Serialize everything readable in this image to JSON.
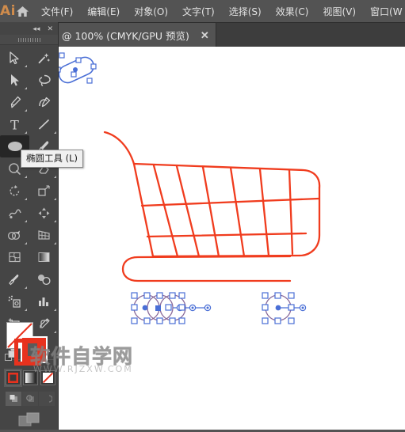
{
  "app": {
    "logo_text": "Ai",
    "home_icon": "home-icon"
  },
  "menubar": {
    "items": [
      {
        "label": "文件(F)",
        "name": "menu-file"
      },
      {
        "label": "编辑(E)",
        "name": "menu-edit"
      },
      {
        "label": "对象(O)",
        "name": "menu-object"
      },
      {
        "label": "文字(T)",
        "name": "menu-type"
      },
      {
        "label": "选择(S)",
        "name": "menu-select"
      },
      {
        "label": "效果(C)",
        "name": "menu-effect"
      },
      {
        "label": "视图(V)",
        "name": "menu-view"
      },
      {
        "label": "窗口(W",
        "name": "menu-window"
      }
    ]
  },
  "tabbar": {
    "tab_title": "@ 100% (CMYK/GPU 预览)",
    "close_label": "✕"
  },
  "toolpanel": {
    "collapse_label": "◂◂",
    "close_label": "✕",
    "tools": [
      {
        "name": "selection-tool",
        "icon": "arrow-outline-icon",
        "has_corner": true
      },
      {
        "name": "magic-wand-tool",
        "icon": "magic-wand-icon",
        "has_corner": false
      },
      {
        "name": "direct-selection-tool",
        "icon": "arrow-filled-icon",
        "has_corner": true
      },
      {
        "name": "lasso-tool",
        "icon": "lasso-icon",
        "has_corner": false
      },
      {
        "name": "pen-tool",
        "icon": "pen-icon",
        "has_corner": true
      },
      {
        "name": "curvature-tool",
        "icon": "curvature-icon",
        "has_corner": false
      },
      {
        "name": "type-tool",
        "icon": "type-t-icon",
        "has_corner": true
      },
      {
        "name": "line-segment-tool",
        "icon": "line-diagonal-icon",
        "has_corner": true
      },
      {
        "name": "ellipse-tool",
        "icon": "ellipse-icon",
        "has_corner": true
      },
      {
        "name": "paintbrush-tool",
        "icon": "paintbrush-icon",
        "has_corner": true
      },
      {
        "name": "shaper-tool",
        "icon": "shaper-icon",
        "has_corner": true
      },
      {
        "name": "eraser-tool",
        "icon": "eraser-icon",
        "has_corner": true
      },
      {
        "name": "rotate-tool",
        "icon": "rotate-icon",
        "has_corner": true
      },
      {
        "name": "scale-tool",
        "icon": "scale-icon",
        "has_corner": true
      },
      {
        "name": "width-tool",
        "icon": "width-warp-icon",
        "has_corner": true
      },
      {
        "name": "free-transform-tool",
        "icon": "free-transform-icon",
        "has_corner": true
      },
      {
        "name": "shape-builder-tool",
        "icon": "shape-builder-icon",
        "has_corner": true
      },
      {
        "name": "perspective-grid-tool",
        "icon": "perspective-grid-icon",
        "has_corner": true
      },
      {
        "name": "mesh-tool",
        "icon": "mesh-icon",
        "has_corner": false
      },
      {
        "name": "gradient-tool",
        "icon": "gradient-icon",
        "has_corner": false
      },
      {
        "name": "eyedropper-tool",
        "icon": "eyedropper-icon",
        "has_corner": true
      },
      {
        "name": "blend-tool",
        "icon": "blend-icon",
        "has_corner": false
      },
      {
        "name": "symbol-sprayer-tool",
        "icon": "symbol-sprayer-icon",
        "has_corner": true
      },
      {
        "name": "column-graph-tool",
        "icon": "bar-chart-icon",
        "has_corner": true
      },
      {
        "name": "artboard-tool",
        "icon": "artboard-icon",
        "has_corner": false
      },
      {
        "name": "slice-tool",
        "icon": "knife-icon",
        "has_corner": true
      },
      {
        "name": "hand-tool",
        "icon": "hand-icon",
        "has_corner": true
      },
      {
        "name": "zoom-tool",
        "icon": "magnifier-icon",
        "has_corner": false
      }
    ],
    "active_tool_index": 8
  },
  "tooltip": {
    "text": "椭圆工具 (L)"
  },
  "colors": {
    "fill": "#ffffff",
    "fill_is_none": true,
    "stroke": "#e8321e",
    "none_slash": "#e8321e",
    "artwork_stroke": "#f03c1e",
    "selection_blue": "#4a6fd6",
    "accent_orange": "#d08c4c",
    "panel_bg": "#454545",
    "chrome_bg": "#535353",
    "tabbar_bg": "#3d3d3d",
    "canvas_bg": "#ffffff"
  },
  "color_controls": {
    "fill_name": "fill-swatch",
    "stroke_name": "stroke-swatch",
    "swap_label": "⤿",
    "mode_buttons": [
      {
        "name": "color-mode-button",
        "selected": true
      },
      {
        "name": "gradient-mode-button",
        "selected": false
      },
      {
        "name": "none-mode-button",
        "selected": false
      }
    ],
    "draw_buttons": [
      {
        "name": "draw-normal-button",
        "selected": true
      },
      {
        "name": "draw-behind-button",
        "selected": false
      },
      {
        "name": "draw-inside-button",
        "selected": false
      }
    ],
    "screen_mode_name": "screen-mode-button"
  },
  "watermark": {
    "title": "软件自学网",
    "url": "WWW.RJZXW.COM"
  },
  "artwork": {
    "name": "shopping-cart-artwork",
    "description": "红色线框购物车图形",
    "selected_objects": [
      {
        "name": "cart-handle-ellipse",
        "shape": "rounded-ellipse",
        "selected": true
      },
      {
        "name": "cart-wheel-group-left",
        "shape": "circles",
        "selected": true
      },
      {
        "name": "cart-wheel-right",
        "shape": "circle",
        "selected": true
      }
    ]
  }
}
